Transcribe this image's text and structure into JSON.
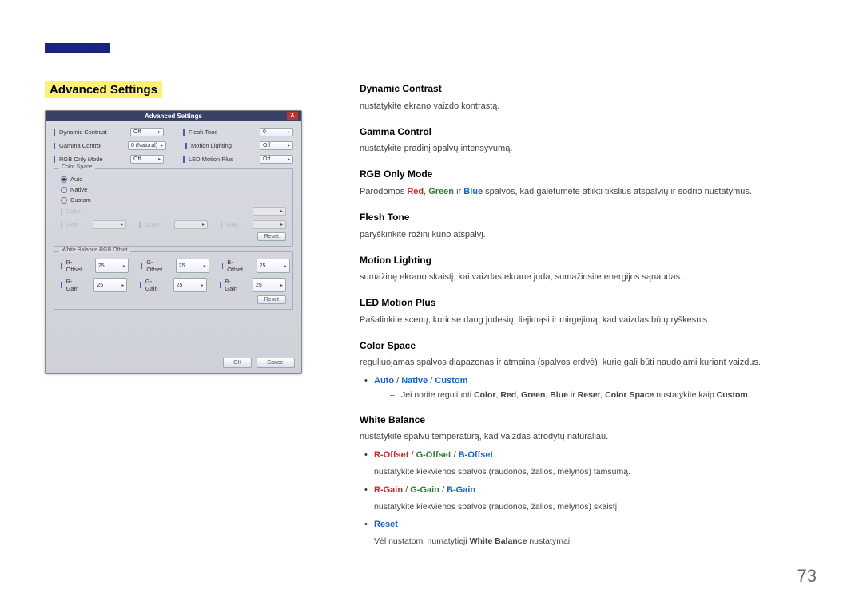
{
  "page_number": "73",
  "section_title": "Advanced Settings",
  "dialog": {
    "title": "Advanced Settings",
    "close": "X",
    "rows_top": [
      {
        "label": "Dynamic Contrast",
        "value": "Off",
        "label2": "Flesh Tone",
        "value2": "0"
      },
      {
        "label": "Gamma Control",
        "value": "0 (Natural)",
        "label2": "Motion Lighting",
        "value2": "Off"
      },
      {
        "label": "RGB Only Mode",
        "value": "Off",
        "label2": "LED Motion Plus",
        "value2": "Off"
      }
    ],
    "color_space": {
      "legend": "Color Space",
      "radios": [
        "Auto",
        "Native",
        "Custom"
      ],
      "selected": "Auto",
      "color_row": {
        "color_lbl": "Color",
        "red_lbl": "Red",
        "green_lbl": "Green",
        "blue_lbl": "Blue"
      },
      "reset": "Reset"
    },
    "wb": {
      "legend": "White Balance RGB Offset",
      "row1": [
        {
          "l": "R-Offset",
          "v": "25"
        },
        {
          "l": "G-Offset",
          "v": "25"
        },
        {
          "l": "B-Offset",
          "v": "25"
        }
      ],
      "row2": [
        {
          "l": "R-Gain",
          "v": "25"
        },
        {
          "l": "G-Gain",
          "v": "25"
        },
        {
          "l": "B-Gain",
          "v": "25"
        }
      ],
      "reset": "Reset"
    },
    "ok": "OK",
    "cancel": "Cancel"
  },
  "items": {
    "dynamic_contrast": {
      "h": "Dynamic Contrast",
      "p": "nustatykite ekrano vaizdo kontrastą."
    },
    "gamma": {
      "h": "Gamma Control",
      "p": "nustatykite pradinį spalvų intensyvumą."
    },
    "rgb_only": {
      "h": "RGB Only Mode",
      "p1": "Parodomos ",
      "p2": " spalvos, kad galėtumėte atlikti tikslius atspalvių ir sodrio nustatymus.",
      "red": "Red",
      "green": "Green",
      "blue": "Blue",
      "sep": ", ",
      "sep2": " ir "
    },
    "flesh": {
      "h": "Flesh Tone",
      "p": "paryškinkite rožinį kūno atspalvį."
    },
    "motion_lighting": {
      "h": "Motion Lighting",
      "p": "sumažinę ekrano skaistį, kai vaizdas ekrane juda, sumažinsite energijos sąnaudas."
    },
    "led_motion": {
      "h": "LED Motion Plus",
      "p": "Pašalinkite scenų, kuriose daug judesių, liejimąsi ir mirgėjimą, kad vaizdas būtų ryškesnis."
    },
    "color_space": {
      "h": "Color Space",
      "p": "reguliuojamas spalvos diapazonas ir atmaina (spalvos erdvė), kurie gali būti naudojami kuriant vaizdus.",
      "opts": {
        "auto": "Auto",
        "native": "Native",
        "custom": "Custom",
        "sep": " / "
      },
      "sub": "Jei norite reguliuoti ",
      "sub_color": "Color",
      "sub_red": "Red",
      "sub_green": "Green",
      "sub_blue": "Blue",
      "sub_reset": "Reset",
      "sub_cs": "Color Space",
      "sub_mid": ", ",
      "sub_ir": " ir ",
      "sub_end": " nustatykite kaip ",
      "sub_custom": "Custom",
      "period": "."
    },
    "white_balance": {
      "h": "White Balance",
      "p": "nustatykite spalvų temperatūrą, kad vaizdas atrodytų natūraliau.",
      "offset": {
        "r": "R-Offset",
        "g": "G-Offset",
        "b": "B-Offset",
        "sep": " / "
      },
      "offset_desc": "nustatykite kiekvienos spalvos (raudonos, žalios, mėlynos) tamsumą.",
      "gain": {
        "r": "R-Gain",
        "g": "G-Gain",
        "b": "B-Gain",
        "sep": " / "
      },
      "gain_desc": "nustatykite kiekvienos spalvos (raudonos, žalios, mėlynos) skaistį.",
      "reset": "Reset",
      "reset_desc_a": "Vėl nustatomi numatytieji ",
      "reset_desc_b": "White Balance",
      "reset_desc_c": " nustatymai."
    }
  }
}
